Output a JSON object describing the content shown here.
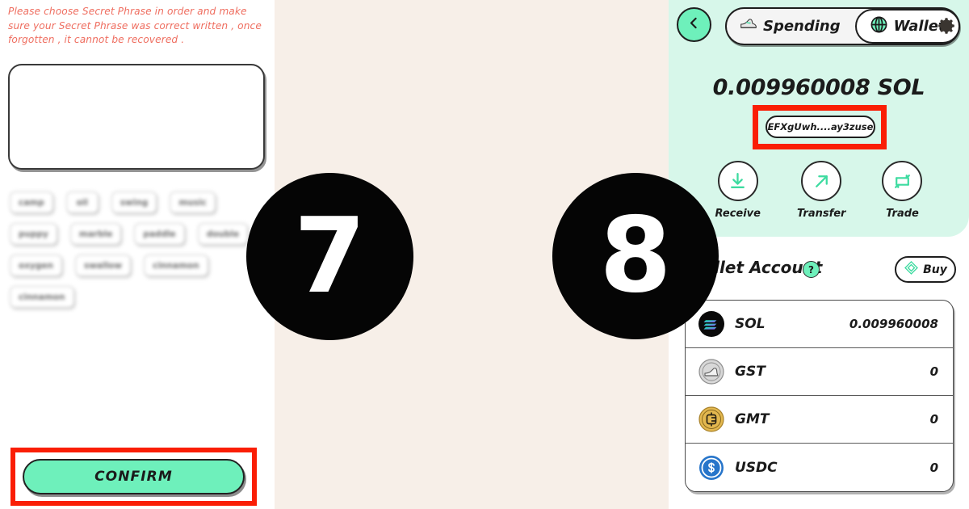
{
  "left_screen": {
    "warning": "Please choose Secret Phrase in order and make sure your Secret Phrase was correct written , once forgotten , it cannot be recovered .",
    "phrase_box_value": "",
    "word_chips": [
      [
        "camp",
        "oil",
        "swing",
        "music"
      ],
      [
        "puppy",
        "marble",
        "paddle",
        "double"
      ],
      [
        "oxygen",
        "swallow",
        "cinnamon"
      ],
      [
        "cinnamon"
      ]
    ],
    "confirm_label": "CONFIRM",
    "highlight_color": "#fa1e05",
    "confirm_bg": "#6ef0bb"
  },
  "steps": {
    "left_number": "7",
    "right_number": "8"
  },
  "right_screen": {
    "back_icon": "chevron-left-icon",
    "segments": [
      {
        "label": "Spending",
        "icon": "sneaker-icon",
        "active": false
      },
      {
        "label": "Wallet",
        "icon": "globe-icon",
        "active": true
      }
    ],
    "settings_icon": "gear-icon",
    "balance": "0.009960008 SOL",
    "address": "EFXgUwh....ay3zuse",
    "actions": [
      {
        "label": "Receive",
        "icon": "download-arrow-icon"
      },
      {
        "label": "Transfer",
        "icon": "arrow-up-right-icon"
      },
      {
        "label": "Trade",
        "icon": "swap-icon"
      }
    ],
    "account_title": "Wallet Account",
    "help_label": "?",
    "buy_label": "Buy",
    "buy_icon": "diamond-icon",
    "tokens": [
      {
        "symbol": "SOL",
        "amount": "0.009960008",
        "icon": "solana-icon"
      },
      {
        "symbol": "GST",
        "amount": "0",
        "icon": "gst-sneaker-icon"
      },
      {
        "symbol": "GMT",
        "amount": "0",
        "icon": "gmt-coin-icon"
      },
      {
        "symbol": "USDC",
        "amount": "0",
        "icon": "usdc-dollar-icon"
      }
    ],
    "header_bg": "#d7f7ea",
    "accent": "#6ef0bb"
  }
}
